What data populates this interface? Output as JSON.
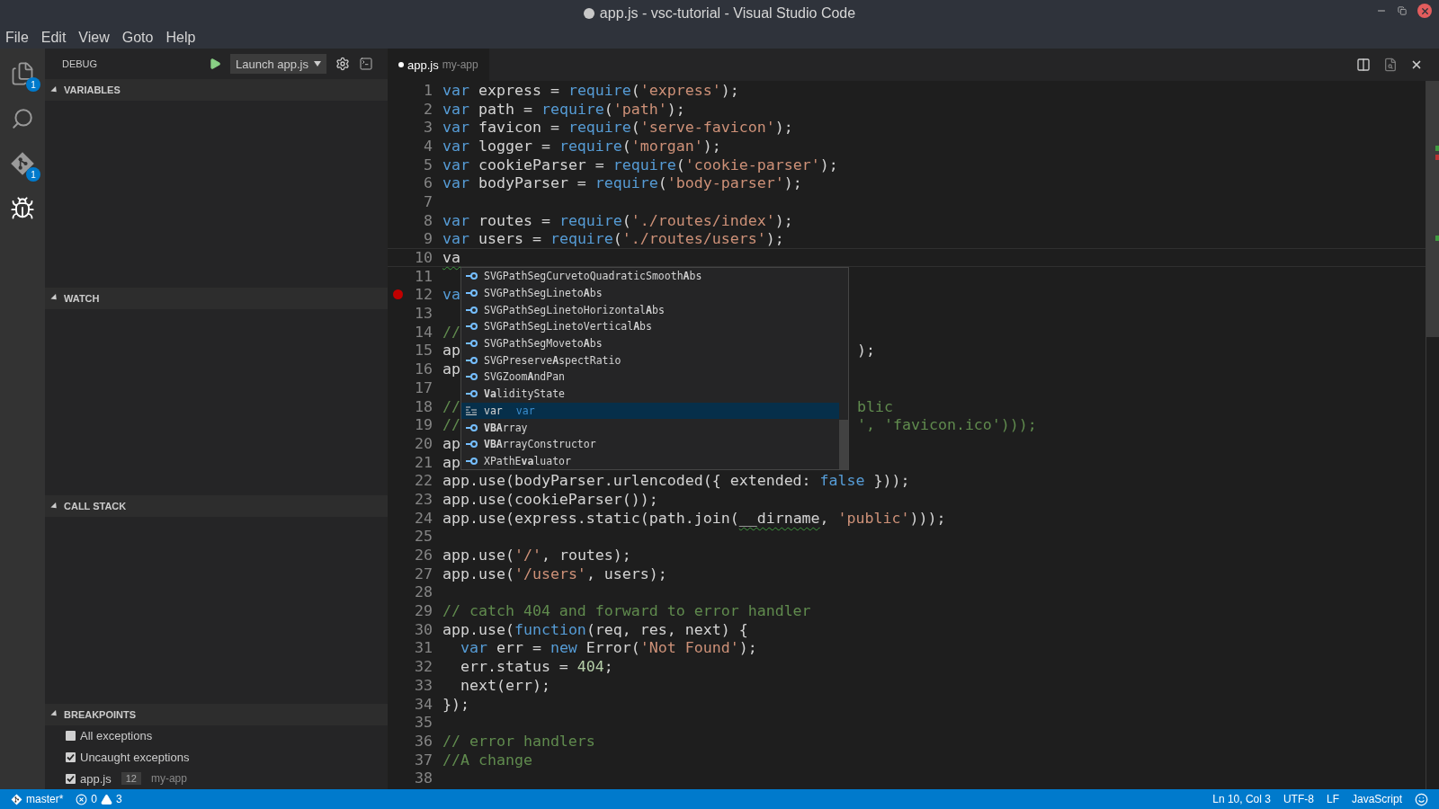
{
  "window": {
    "title": "app.js - vsc-tutorial - Visual Studio Code",
    "dirty": true
  },
  "menu": [
    "File",
    "Edit",
    "View",
    "Goto",
    "Help"
  ],
  "activity_bar": [
    {
      "kind": "files",
      "badge": "1",
      "selected": false
    },
    {
      "kind": "search",
      "selected": false
    },
    {
      "kind": "git",
      "badge": "1",
      "selected": false
    },
    {
      "kind": "debug",
      "selected": true
    }
  ],
  "debug": {
    "title": "DEBUG",
    "configuration": "Launch app.js",
    "sections": [
      {
        "title": "VARIABLES",
        "expanded": true
      },
      {
        "title": "WATCH",
        "expanded": true
      },
      {
        "title": "CALL STACK",
        "expanded": true
      },
      {
        "title": "BREAKPOINTS",
        "expanded": true,
        "items": [
          {
            "label": "All exceptions",
            "checked": false
          },
          {
            "label": "Uncaught exceptions",
            "checked": true
          },
          {
            "label": "app.js",
            "line": "12",
            "description": "my-app",
            "checked": true
          }
        ]
      }
    ]
  },
  "editor": {
    "tab": {
      "label": "app.js",
      "description": "my-app",
      "dirty": true,
      "selected": true
    },
    "lines": [
      {
        "number": "1",
        "tokens": [
          {
            "kind": "keyword",
            "text": "var"
          },
          {
            "kind": "plain",
            "text": " express = "
          },
          {
            "kind": "keyword",
            "text": "require"
          },
          {
            "kind": "plain",
            "text": "("
          },
          {
            "kind": "string",
            "text": "'express'"
          },
          {
            "kind": "plain",
            "text": ");"
          }
        ]
      },
      {
        "number": "2",
        "tokens": [
          {
            "kind": "keyword",
            "text": "var"
          },
          {
            "kind": "plain",
            "text": " path = "
          },
          {
            "kind": "keyword",
            "text": "require"
          },
          {
            "kind": "plain",
            "text": "("
          },
          {
            "kind": "string",
            "text": "'path'"
          },
          {
            "kind": "plain",
            "text": ");"
          }
        ]
      },
      {
        "number": "3",
        "tokens": [
          {
            "kind": "keyword",
            "text": "var"
          },
          {
            "kind": "plain",
            "text": " favicon = "
          },
          {
            "kind": "keyword",
            "text": "require"
          },
          {
            "kind": "plain",
            "text": "("
          },
          {
            "kind": "string",
            "text": "'serve-favicon'"
          },
          {
            "kind": "plain",
            "text": ");"
          }
        ]
      },
      {
        "number": "4",
        "tokens": [
          {
            "kind": "keyword",
            "text": "var"
          },
          {
            "kind": "plain",
            "text": " logger = "
          },
          {
            "kind": "keyword",
            "text": "require"
          },
          {
            "kind": "plain",
            "text": "("
          },
          {
            "kind": "string",
            "text": "'morgan'"
          },
          {
            "kind": "plain",
            "text": ");"
          }
        ]
      },
      {
        "number": "5",
        "tokens": [
          {
            "kind": "keyword",
            "text": "var"
          },
          {
            "kind": "plain",
            "text": " cookieParser = "
          },
          {
            "kind": "keyword",
            "text": "require"
          },
          {
            "kind": "plain",
            "text": "("
          },
          {
            "kind": "string",
            "text": "'cookie-parser'"
          },
          {
            "kind": "plain",
            "text": ");"
          }
        ]
      },
      {
        "number": "6",
        "tokens": [
          {
            "kind": "keyword",
            "text": "var"
          },
          {
            "kind": "plain",
            "text": " bodyParser = "
          },
          {
            "kind": "keyword",
            "text": "require"
          },
          {
            "kind": "plain",
            "text": "("
          },
          {
            "kind": "string",
            "text": "'body-parser'"
          },
          {
            "kind": "plain",
            "text": ");"
          }
        ]
      },
      {
        "number": "7"
      },
      {
        "number": "8",
        "tokens": [
          {
            "kind": "keyword",
            "text": "var"
          },
          {
            "kind": "plain",
            "text": " routes = "
          },
          {
            "kind": "keyword",
            "text": "require"
          },
          {
            "kind": "plain",
            "text": "("
          },
          {
            "kind": "string",
            "text": "'./routes/index'"
          },
          {
            "kind": "plain",
            "text": ");"
          }
        ]
      },
      {
        "number": "9",
        "tokens": [
          {
            "kind": "keyword",
            "text": "var"
          },
          {
            "kind": "plain",
            "text": " users = "
          },
          {
            "kind": "keyword",
            "text": "require"
          },
          {
            "kind": "plain",
            "text": "("
          },
          {
            "kind": "string",
            "text": "'./routes/users'"
          },
          {
            "kind": "plain",
            "text": ");"
          }
        ]
      },
      {
        "number": "10",
        "current": true,
        "tokens": [
          {
            "kind": "plain",
            "text": "va",
            "squiggle": true
          }
        ]
      },
      {
        "number": "11"
      },
      {
        "number": "12",
        "breakpoint": true,
        "tokens": [
          {
            "kind": "keyword",
            "text": "va"
          }
        ]
      },
      {
        "number": "13"
      },
      {
        "number": "14",
        "tokens": [
          {
            "kind": "comment",
            "text": "//"
          }
        ]
      },
      {
        "number": "15",
        "tokens": [
          {
            "kind": "plain",
            "text": "ap"
          },
          {
            "kind": "plain",
            "text": ");",
            "after_popup": true
          }
        ]
      },
      {
        "number": "16",
        "tokens": [
          {
            "kind": "plain",
            "text": "ap"
          }
        ]
      },
      {
        "number": "17"
      },
      {
        "number": "18",
        "tokens": [
          {
            "kind": "comment",
            "text": "//"
          },
          {
            "kind": "comment",
            "text": "blic",
            "after_popup": true
          }
        ]
      },
      {
        "number": "19",
        "tokens": [
          {
            "kind": "comment",
            "text": "//"
          },
          {
            "kind": "comment",
            "text": "', 'favicon.ico')));",
            "after_popup": true
          }
        ]
      },
      {
        "number": "20",
        "tokens": [
          {
            "kind": "plain",
            "text": "ap"
          }
        ]
      },
      {
        "number": "21",
        "tokens": [
          {
            "kind": "plain",
            "text": "ap"
          }
        ]
      },
      {
        "number": "22",
        "tokens": [
          {
            "kind": "plain",
            "text": "app.use(bodyParser.urlencoded({ extended: "
          },
          {
            "kind": "keyword",
            "text": "false"
          },
          {
            "kind": "plain",
            "text": " }));"
          }
        ]
      },
      {
        "number": "23",
        "tokens": [
          {
            "kind": "plain",
            "text": "app.use(cookieParser());"
          }
        ]
      },
      {
        "number": "24",
        "tokens": [
          {
            "kind": "plain",
            "text": "app.use(express.static(path.join("
          },
          {
            "kind": "plain",
            "text": "__dirname",
            "squiggle": true
          },
          {
            "kind": "plain",
            "text": ", "
          },
          {
            "kind": "string",
            "text": "'public'"
          },
          {
            "kind": "plain",
            "text": ")));"
          }
        ]
      },
      {
        "number": "25"
      },
      {
        "number": "26",
        "tokens": [
          {
            "kind": "plain",
            "text": "app.use("
          },
          {
            "kind": "string",
            "text": "'/'"
          },
          {
            "kind": "plain",
            "text": ", routes);"
          }
        ]
      },
      {
        "number": "27",
        "tokens": [
          {
            "kind": "plain",
            "text": "app.use("
          },
          {
            "kind": "string",
            "text": "'/users'"
          },
          {
            "kind": "plain",
            "text": ", users);"
          }
        ]
      },
      {
        "number": "28"
      },
      {
        "number": "29",
        "tokens": [
          {
            "kind": "comment",
            "text": "// catch 404 and forward to error handler"
          }
        ]
      },
      {
        "number": "30",
        "tokens": [
          {
            "kind": "plain",
            "text": "app.use("
          },
          {
            "kind": "keyword",
            "text": "function"
          },
          {
            "kind": "plain",
            "text": "(req, res, next) {"
          }
        ]
      },
      {
        "number": "31",
        "tokens": [
          {
            "kind": "keyword",
            "text": "  var"
          },
          {
            "kind": "plain",
            "text": " err = "
          },
          {
            "kind": "keyword",
            "text": "new"
          },
          {
            "kind": "plain",
            "text": " Error("
          },
          {
            "kind": "string",
            "text": "'Not Found'"
          },
          {
            "kind": "plain",
            "text": ");"
          }
        ]
      },
      {
        "number": "32",
        "tokens": [
          {
            "kind": "plain",
            "text": "  err.status = "
          },
          {
            "kind": "number",
            "text": "404"
          },
          {
            "kind": "plain",
            "text": ";"
          }
        ]
      },
      {
        "number": "33",
        "tokens": [
          {
            "kind": "plain",
            "text": "  next(err);"
          }
        ]
      },
      {
        "number": "34",
        "tokens": [
          {
            "kind": "plain",
            "text": "});"
          }
        ]
      },
      {
        "number": "35"
      },
      {
        "number": "36",
        "tokens": [
          {
            "kind": "comment",
            "text": "// error handlers"
          }
        ]
      },
      {
        "number": "37",
        "tokens": [
          {
            "kind": "comment",
            "text": "//A change"
          }
        ]
      },
      {
        "number": "38"
      }
    ],
    "suggestions": [
      {
        "kind": "class",
        "label": "SVGPathSegCurvetoQuadraticSmooth**A**bs",
        "selected": false
      },
      {
        "kind": "class",
        "label": "SVGPathSegLineto**A**bs",
        "selected": false
      },
      {
        "kind": "class",
        "label": "SVGPathSegLinetoHorizontal**A**bs",
        "selected": false
      },
      {
        "kind": "class",
        "label": "SVGPathSegLinetoVertical**A**bs",
        "selected": false
      },
      {
        "kind": "class",
        "label": "SVGPathSegMoveto**A**bs",
        "selected": false
      },
      {
        "kind": "class",
        "label": "SVGPreserve**A**spectRatio",
        "selected": false
      },
      {
        "kind": "class",
        "label": "SVGZoom**A**ndPan",
        "selected": false
      },
      {
        "kind": "class",
        "label": "**Va**lidityState",
        "selected": false
      },
      {
        "kind": "keyword",
        "label": "var",
        "detail": "var",
        "selected": true
      },
      {
        "kind": "class",
        "label": "**VBA**rray",
        "selected": false
      },
      {
        "kind": "class",
        "label": "**VBA**rrayConstructor",
        "selected": false
      },
      {
        "kind": "class",
        "label": "XPathE**va**luator",
        "selected": false
      }
    ]
  },
  "status_bar": {
    "branch": "master*",
    "errors": "0",
    "warnings": "3",
    "position": "Ln 10, Col 3",
    "encoding": "UTF-8",
    "eol": "LF",
    "language": "JavaScript"
  }
}
